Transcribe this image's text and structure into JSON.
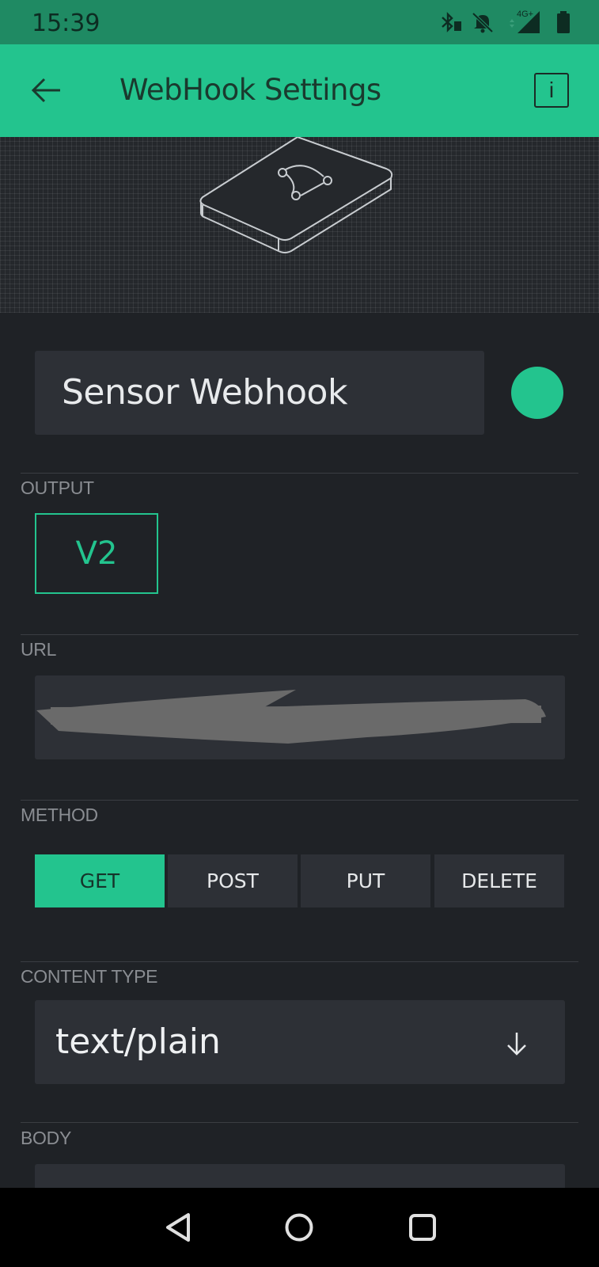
{
  "status_bar": {
    "time": "15:39",
    "icons": [
      "bluetooth-icon",
      "bell-off-icon",
      "network-4g-icon",
      "battery-icon"
    ],
    "network_label": "4G+"
  },
  "app_bar": {
    "title": "WebHook Settings",
    "back_icon": "arrow-left-icon",
    "info_label": "i"
  },
  "hero": {
    "icon": "webhook-device-icon"
  },
  "widget": {
    "name": "Sensor Webhook",
    "color": "#23c48e"
  },
  "output": {
    "label": "OUTPUT",
    "pin": "V2"
  },
  "url": {
    "label": "URL",
    "value_redacted": true
  },
  "method": {
    "label": "METHOD",
    "options": [
      "GET",
      "POST",
      "PUT",
      "DELETE"
    ],
    "selected": "GET"
  },
  "content_type": {
    "label": "CONTENT TYPE",
    "value": "text/plain",
    "icon": "arrow-down-icon"
  },
  "body": {
    "label": "BODY"
  },
  "nav_bar": {
    "icons": [
      "back-triangle-icon",
      "home-circle-icon",
      "recents-square-icon"
    ]
  },
  "colors": {
    "accent": "#23c48e",
    "background": "#1f2226",
    "field_bg": "#2d3036",
    "status_bar": "#1f8a63"
  }
}
